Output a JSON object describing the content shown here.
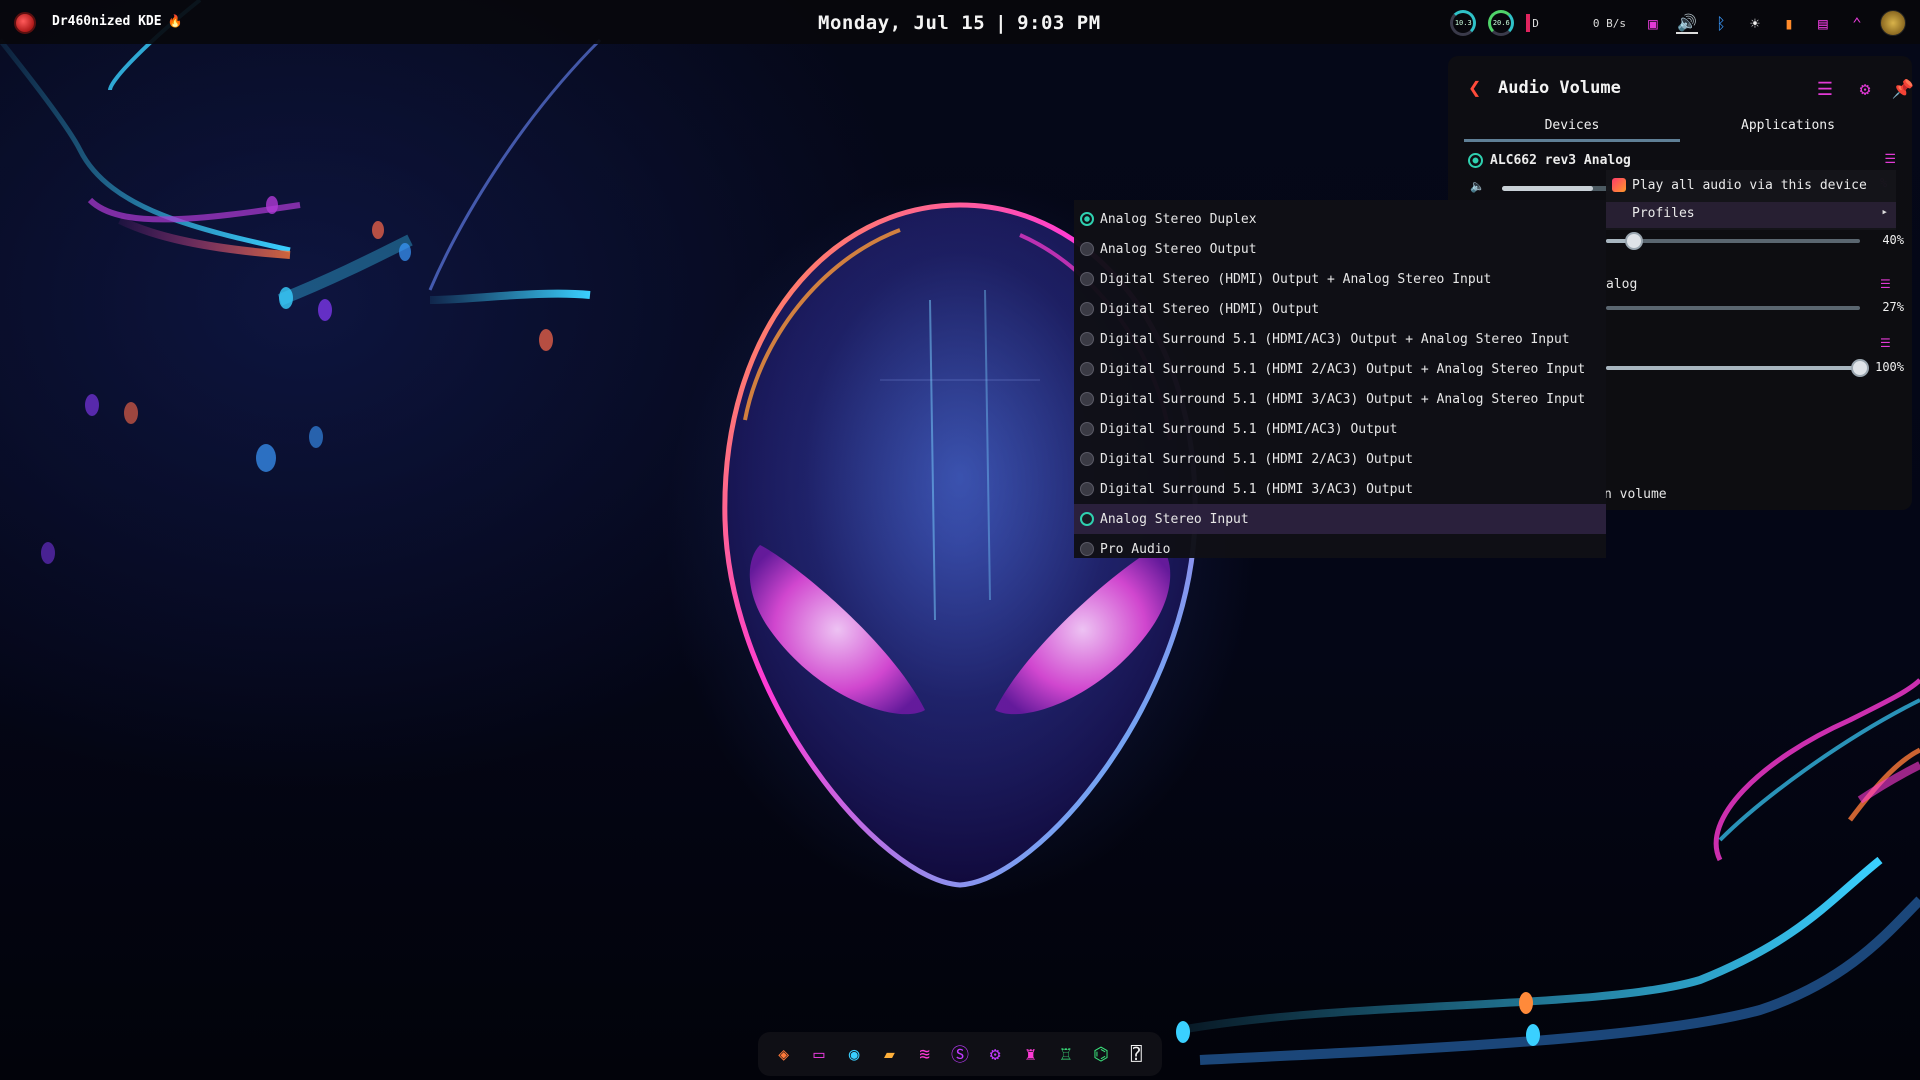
{
  "panel": {
    "title": "Dr460nized KDE",
    "clock_date": "Monday, Jul 15",
    "clock_sep": "|",
    "clock_time": "9:03 PM",
    "gauge1": "10.3",
    "gauge2": "20.6",
    "disk_label": "D",
    "net_speed": "0 B/s",
    "tray_icons": [
      "clipboard-icon",
      "volume-icon",
      "bluetooth-icon",
      "brightness-icon",
      "battery-icon",
      "screen-icon",
      "chevron-up-icon",
      "user-avatar"
    ]
  },
  "audio": {
    "title": "Audio Volume",
    "tabs": [
      "Devices",
      "Applications"
    ],
    "active_tab": "Devices",
    "device_name": "ALC662 rev3 Analog",
    "device_volume_fraction": 0.72,
    "partial_pct_1": "%",
    "slider1": {
      "pct": "40%",
      "value": 0.11
    },
    "stream2_label": "alog",
    "slider2": {
      "pct": "27%",
      "value": 0.0
    },
    "slider3": {
      "pct": "100%",
      "value": 1.0
    },
    "footer_label": "n volume",
    "context_menu": {
      "play_all": "Play all audio via this device",
      "profiles": "Profiles"
    },
    "profiles": [
      {
        "label": "Analog Stereo Duplex",
        "state": "checked"
      },
      {
        "label": "Analog Stereo Output",
        "state": "off"
      },
      {
        "label": "Digital Stereo (HDMI) Output + Analog Stereo Input",
        "state": "off"
      },
      {
        "label": "Digital Stereo (HDMI) Output",
        "state": "off"
      },
      {
        "label": "Digital Surround 5.1 (HDMI/AC3) Output + Analog Stereo Input",
        "state": "off"
      },
      {
        "label": "Digital Surround 5.1 (HDMI 2/AC3) Output + Analog Stereo Input",
        "state": "off"
      },
      {
        "label": "Digital Surround 5.1 (HDMI 3/AC3) Output + Analog Stereo Input",
        "state": "off"
      },
      {
        "label": "Digital Surround 5.1 (HDMI/AC3) Output",
        "state": "off"
      },
      {
        "label": "Digital Surround 5.1 (HDMI 2/AC3) Output",
        "state": "off"
      },
      {
        "label": "Digital Surround 5.1 (HDMI 3/AC3) Output",
        "state": "off"
      },
      {
        "label": "Analog Stereo Input",
        "state": "hover"
      },
      {
        "label": "Pro Audio",
        "state": "off"
      }
    ]
  },
  "dock": {
    "icons": [
      "garuda-icon",
      "terminal-icon",
      "browser-icon",
      "files-icon",
      "system-monitor-icon",
      "settings-s-icon",
      "gear-icon",
      "ghost-icon",
      "game-icon",
      "network-icon",
      "help-doc-icon"
    ]
  },
  "colors": {
    "accent_magenta": "#e23ad6",
    "accent_teal": "#2fd0b0",
    "accent_red": "#ff4b3a",
    "pin_green": "#3ee06a"
  }
}
